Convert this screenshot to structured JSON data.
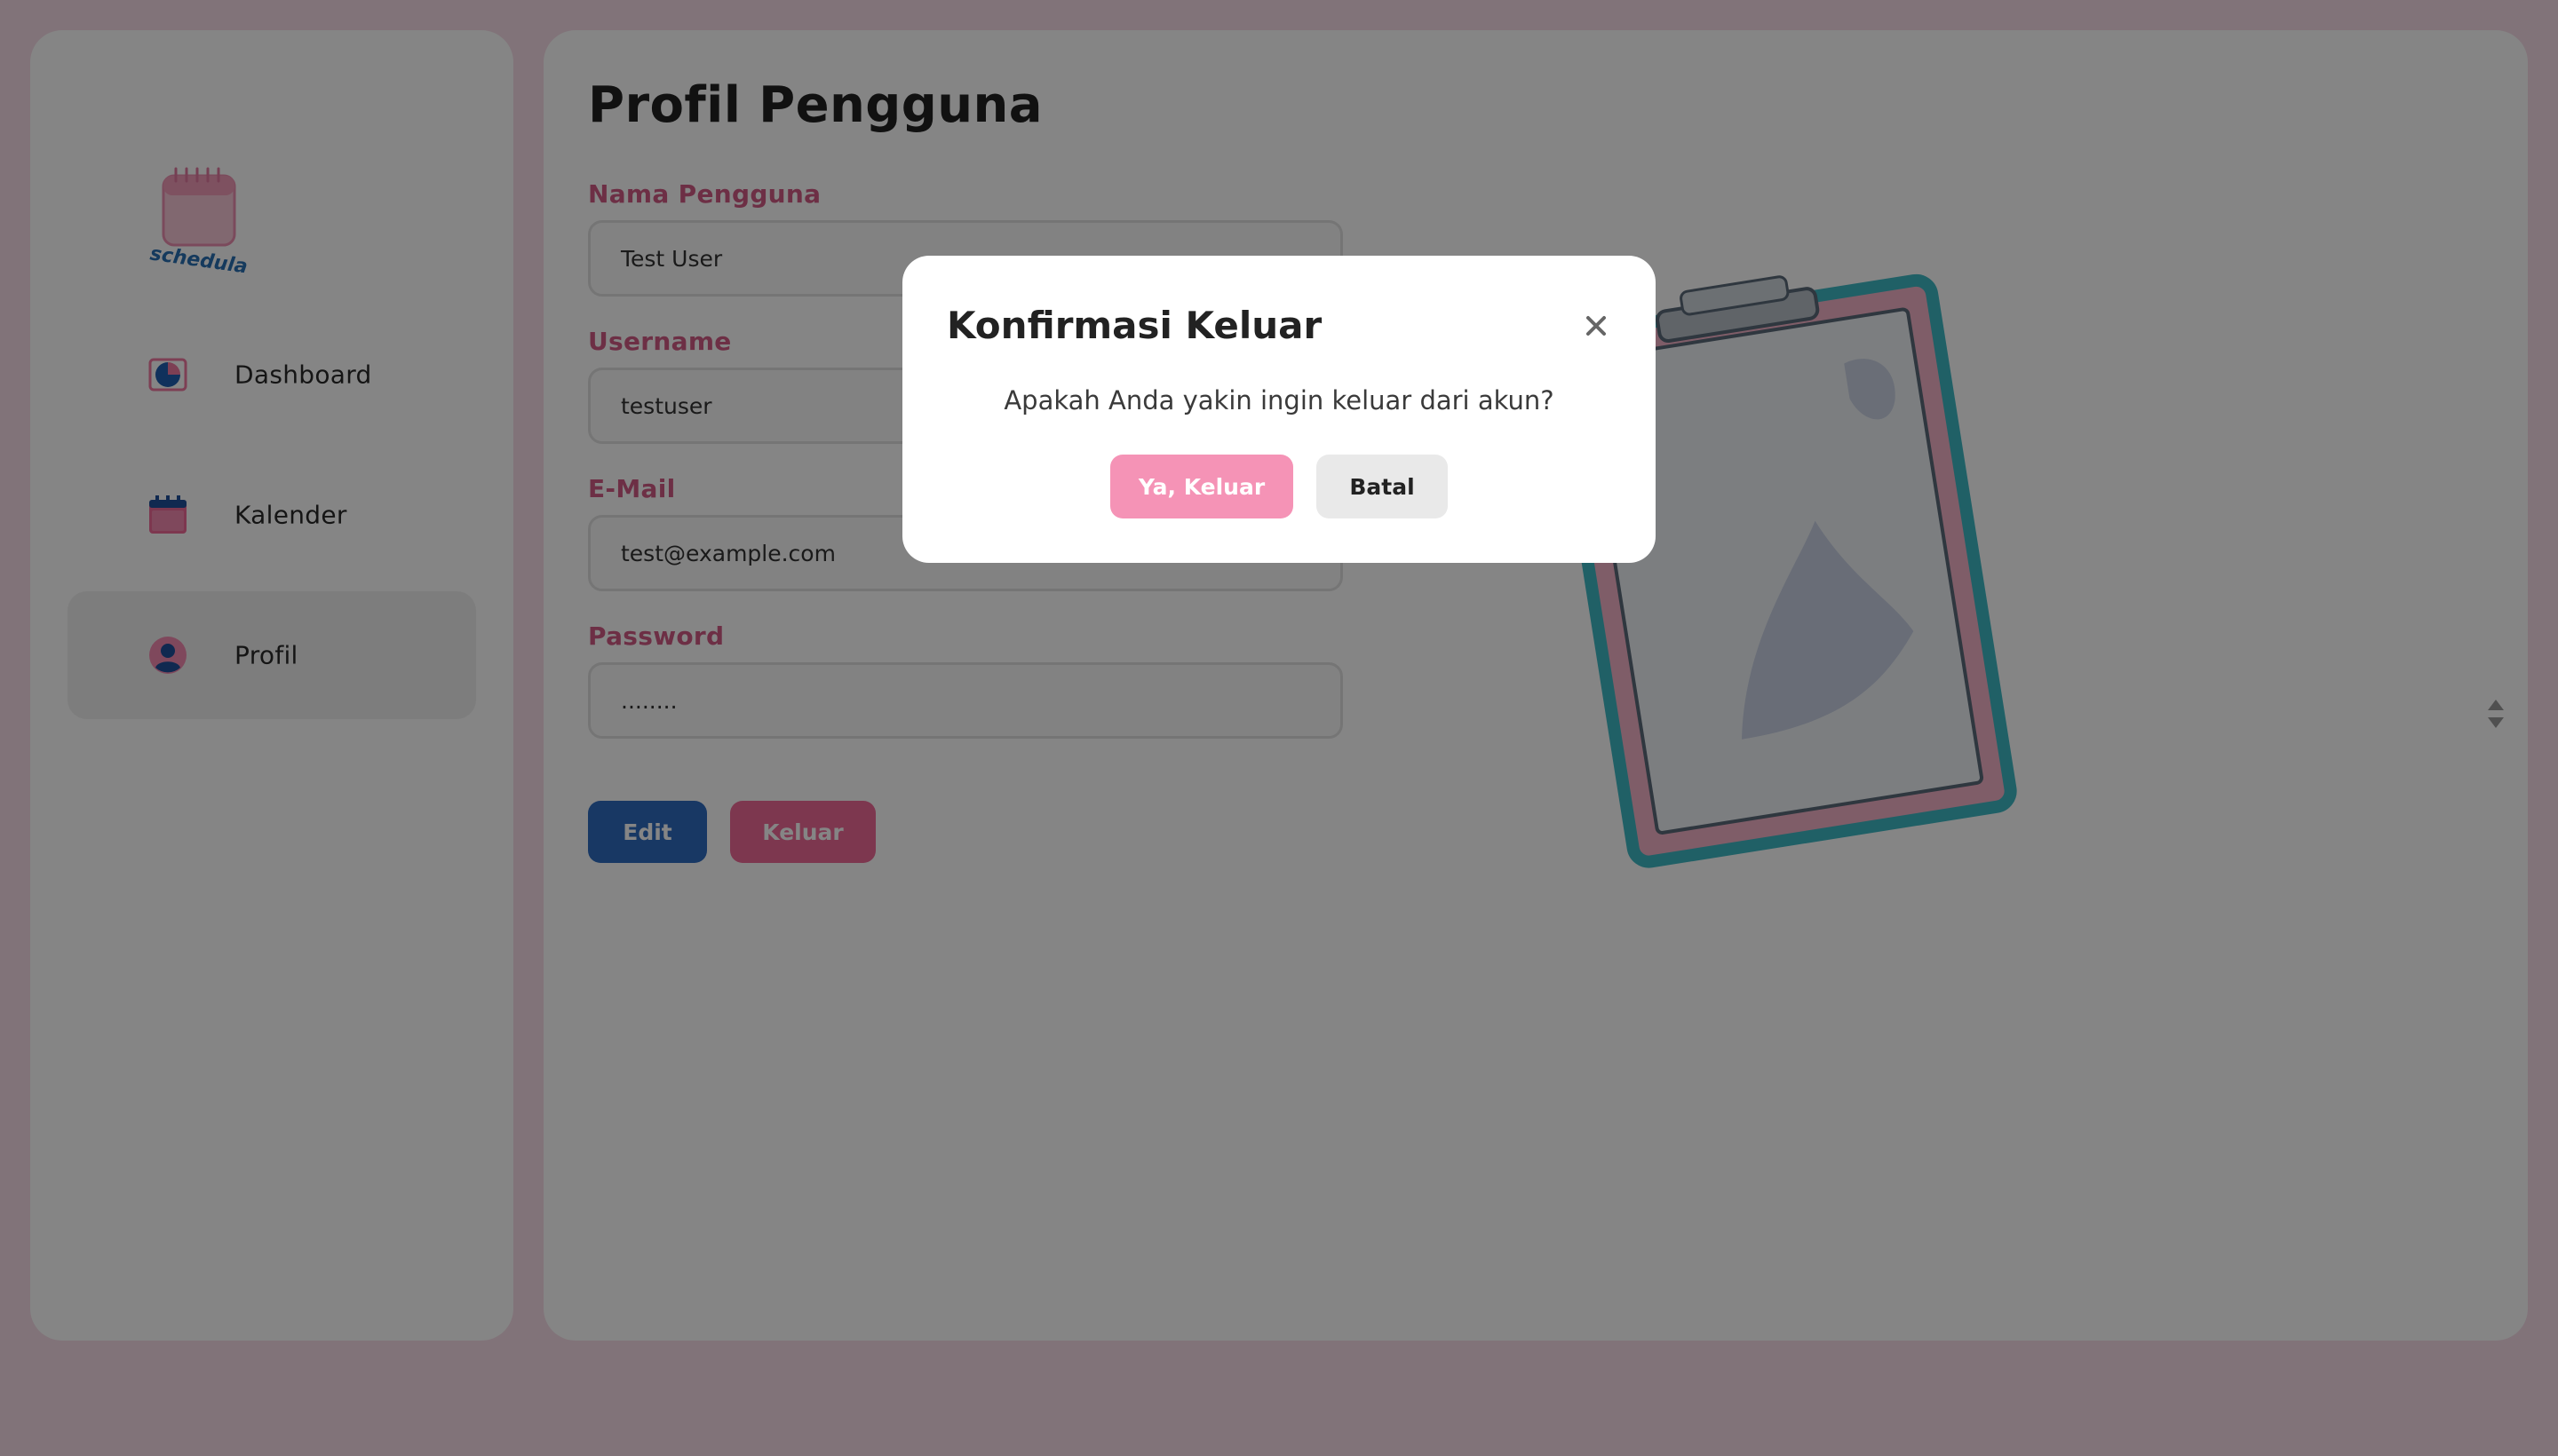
{
  "app": {
    "logo_text": "schedula"
  },
  "sidebar": {
    "items": [
      {
        "label": "Dashboard",
        "icon": "dashboard-icon",
        "active": false
      },
      {
        "label": "Kalender",
        "icon": "calendar-icon",
        "active": false
      },
      {
        "label": "Profil",
        "icon": "profile-icon",
        "active": true
      }
    ]
  },
  "main": {
    "title": "Profil Pengguna",
    "fields": [
      {
        "label": "Nama Pengguna",
        "value": "Test User"
      },
      {
        "label": "Username",
        "value": "testuser"
      },
      {
        "label": "E-Mail",
        "value": "test@example.com"
      },
      {
        "label": "Password",
        "value": "........"
      }
    ],
    "buttons": {
      "edit": "Edit",
      "logout": "Keluar"
    },
    "illustration": "clipboard-illustration"
  },
  "modal": {
    "title": "Konfirmasi Keluar",
    "message": "Apakah Anda yakin ingin keluar dari akun?",
    "confirm_label": "Ya, Keluar",
    "cancel_label": "Batal",
    "close_icon": "close-icon"
  },
  "colors": {
    "background": "#f7dde8",
    "accent_pink": "#ef6a98",
    "label_pink": "#d25a84",
    "edit_blue": "#2f6cc0",
    "confirm_pink": "#f593b6"
  }
}
